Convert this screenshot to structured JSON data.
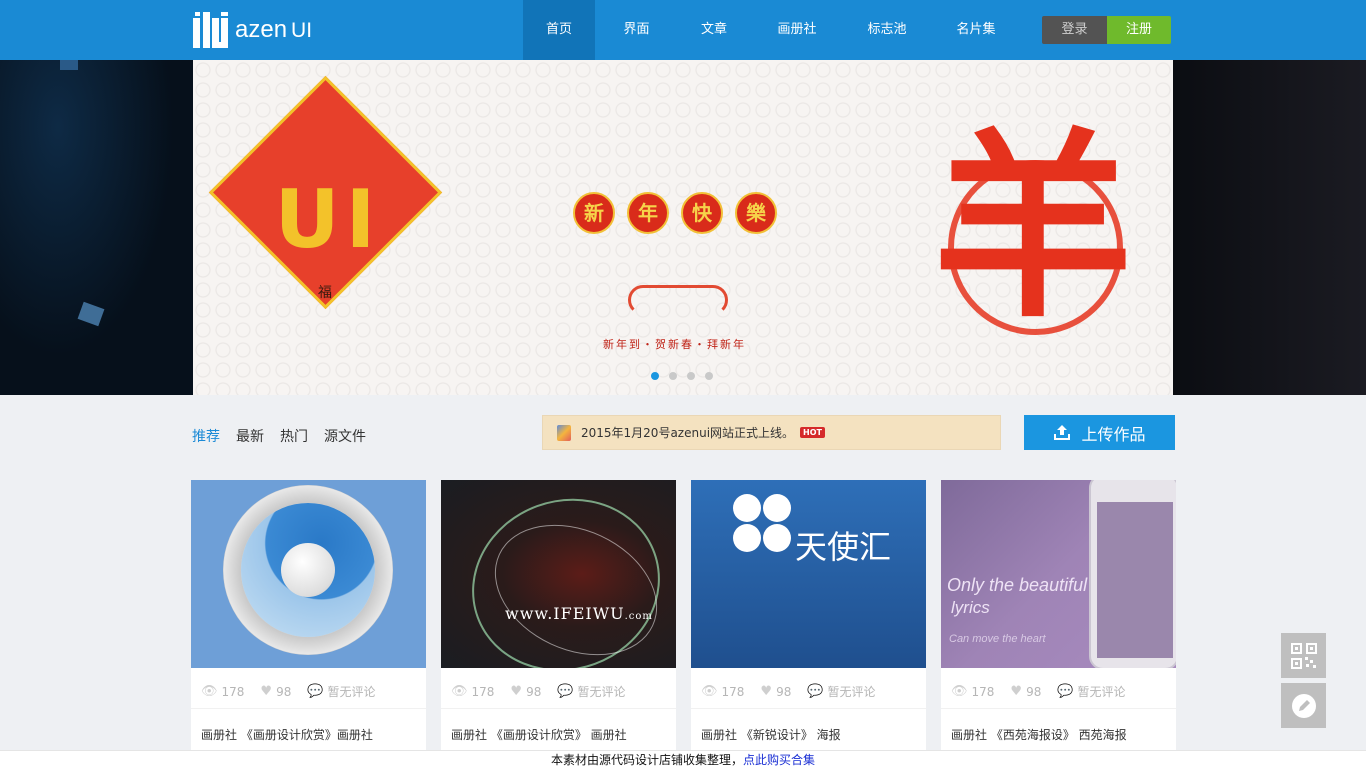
{
  "header": {
    "logo_text": "azen",
    "logo_suffix": "UI",
    "nav": [
      {
        "label": "首页",
        "active": true
      },
      {
        "label": "界面",
        "active": false
      },
      {
        "label": "文章",
        "active": false
      },
      {
        "label": "画册社",
        "active": false
      },
      {
        "label": "标志池",
        "active": false
      },
      {
        "label": "名片集",
        "active": false
      }
    ],
    "login_label": "登录",
    "register_label": "注册",
    "colors": {
      "bar": "#1a8ad4",
      "active": "#1174b8",
      "register": "#6fba2c",
      "login": "#535353"
    }
  },
  "banner": {
    "diamond_text": "UI",
    "diamond_sub": "福",
    "greeting_chars": [
      "新",
      "年",
      "快",
      "樂"
    ],
    "sub_greeting": "新年到・贺新春・拜新年",
    "big_char": "羊",
    "slides": 4,
    "active_slide": 0
  },
  "filter_tabs": [
    {
      "label": "推荐",
      "active": true
    },
    {
      "label": "最新",
      "active": false
    },
    {
      "label": "热门",
      "active": false
    },
    {
      "label": "源文件",
      "active": false
    }
  ],
  "notice": {
    "text": "2015年1月20号azenui网站正式上线。",
    "badge": "HOT"
  },
  "upload_label": "上传作品",
  "cards": [
    {
      "views": "178",
      "likes": "98",
      "comments": "暂无评论",
      "title": "画册社 《画册设计欣赏》画册社"
    },
    {
      "views": "178",
      "likes": "98",
      "comments": "暂无评论",
      "title": "画册社 《画册设计欣赏》 画册社",
      "art_text": "www.IFEIWU",
      "art_suffix": ".com"
    },
    {
      "views": "178",
      "likes": "98",
      "comments": "暂无评论",
      "title": "画册社 《新锐设计》 海报",
      "art_text": "天使汇"
    },
    {
      "views": "178",
      "likes": "98",
      "comments": "暂无评论",
      "title": "画册社 《西苑海报设》 西苑海报",
      "art_line1": "Only the beautiful",
      "art_line2": "lyrics",
      "art_line3": "Can move the heart"
    }
  ],
  "side_tools": [
    "qr-code-icon",
    "edit-icon"
  ],
  "footer": {
    "text": "本素材由源代码设计店铺收集整理，",
    "link": "点此购买合集"
  }
}
